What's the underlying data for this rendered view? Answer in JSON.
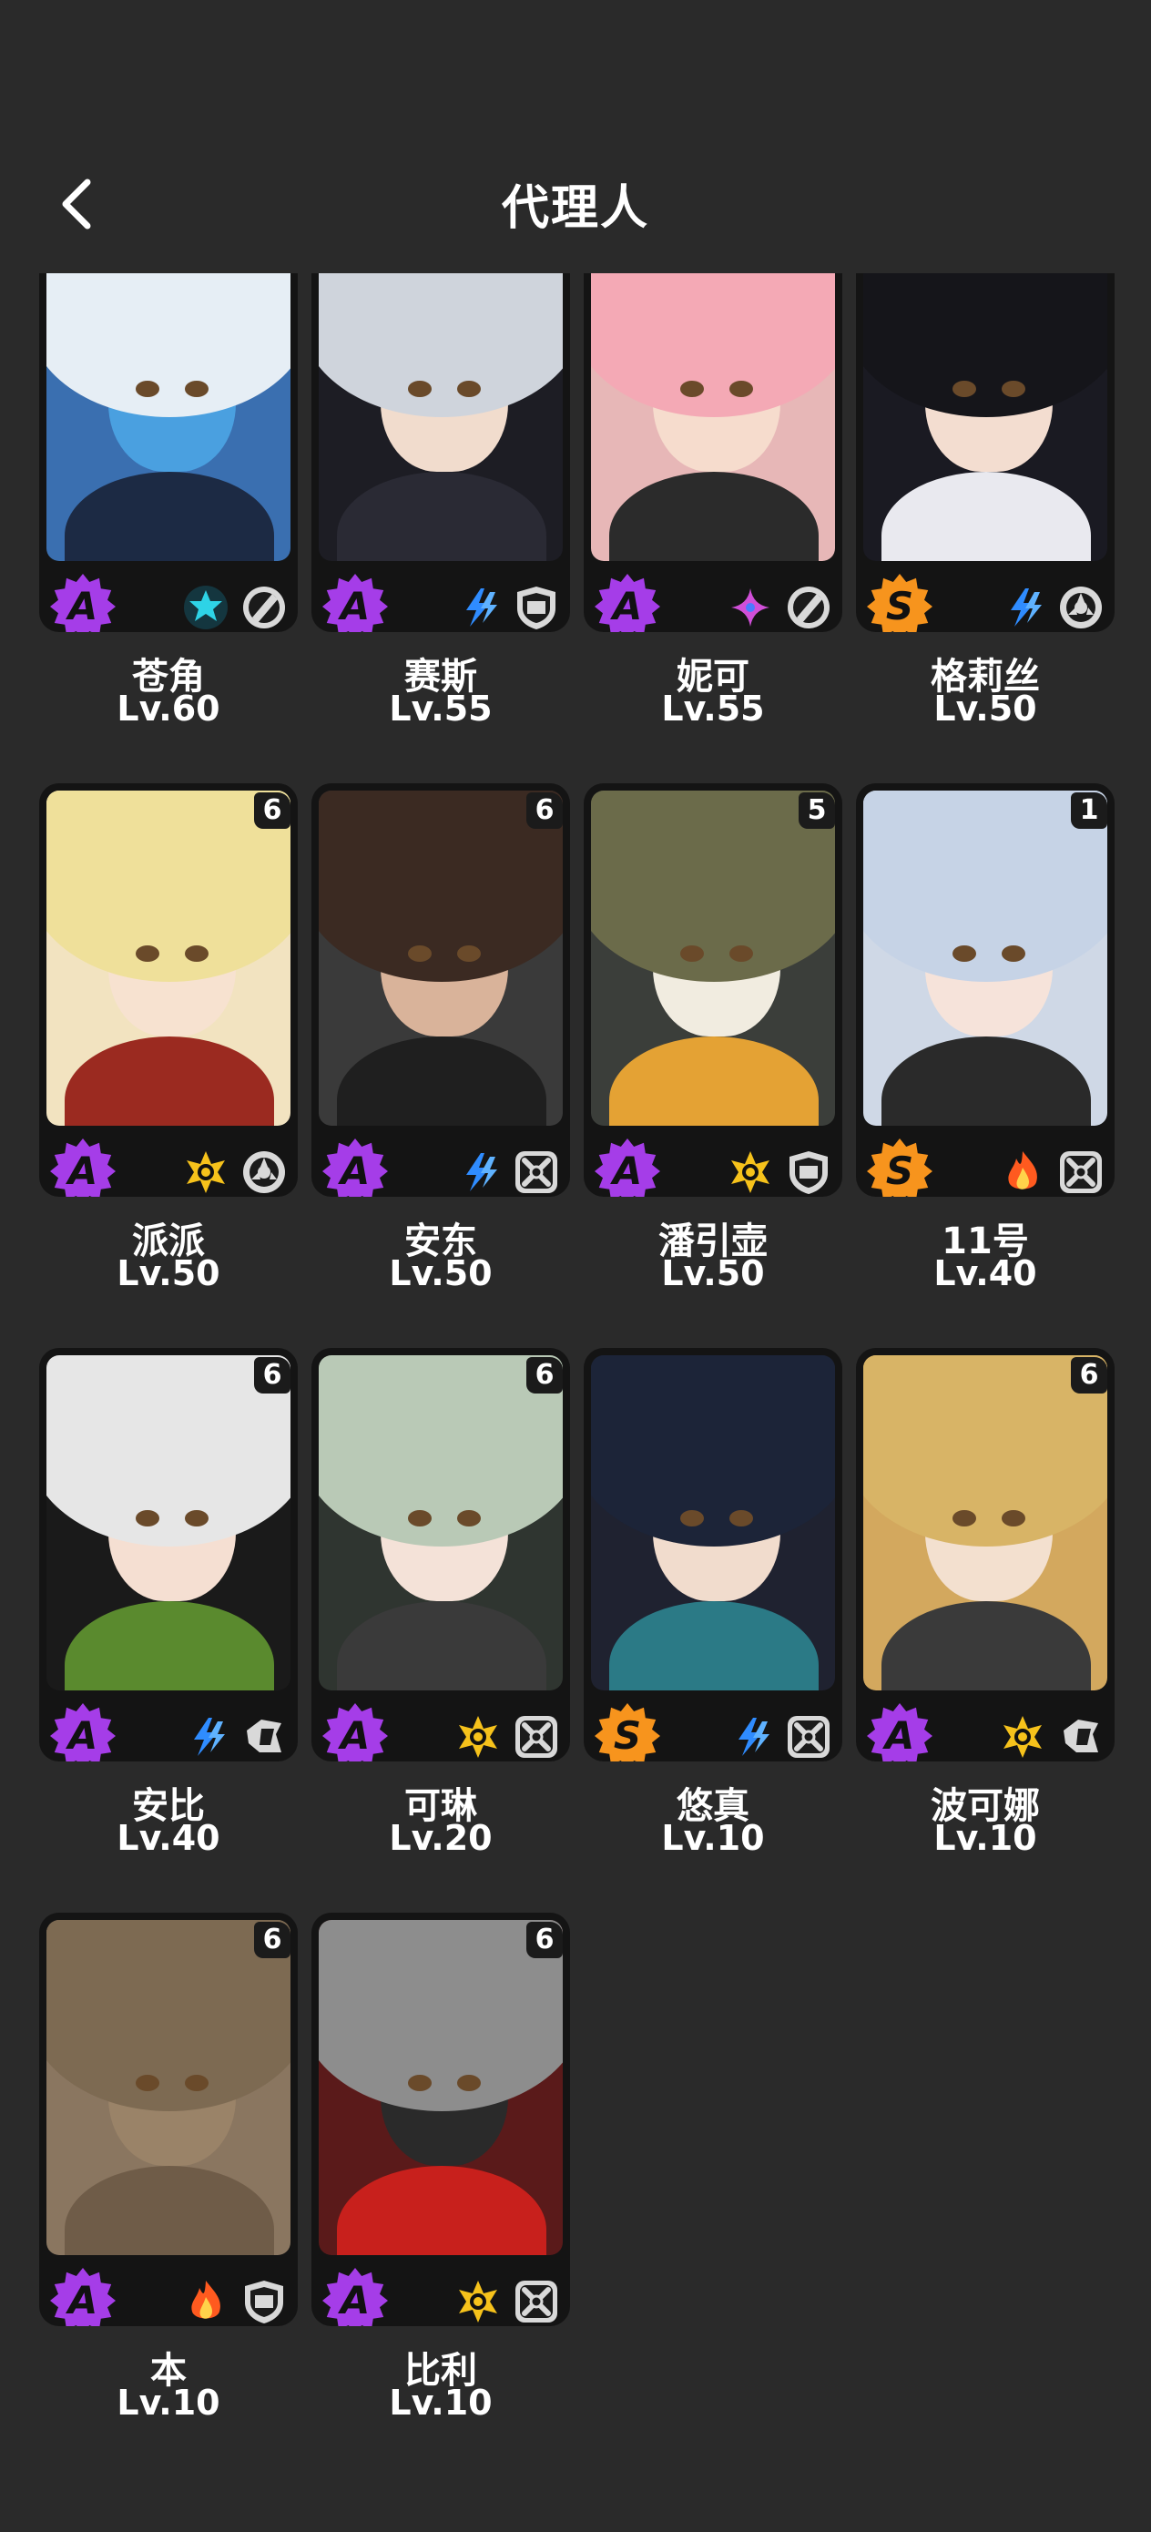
{
  "header": {
    "title": "代理人"
  },
  "colors": {
    "rank_A": "#a53de8",
    "rank_S": "#f7941d",
    "background": "#2a2a2a"
  },
  "agents": [
    {
      "name": "苍角",
      "level": "Lv.60",
      "rank": "A",
      "mindscape": "",
      "attribute": "ice-icon",
      "specialty": "support-icon"
    },
    {
      "name": "赛斯",
      "level": "Lv.55",
      "rank": "A",
      "mindscape": "",
      "attribute": "electric-icon",
      "specialty": "defense-icon"
    },
    {
      "name": "妮可",
      "level": "Lv.55",
      "rank": "A",
      "mindscape": "",
      "attribute": "ether-icon",
      "specialty": "support-icon"
    },
    {
      "name": "格莉丝",
      "level": "Lv.50",
      "rank": "S",
      "mindscape": "",
      "attribute": "electric-icon",
      "specialty": "anomaly-icon"
    },
    {
      "name": "派派",
      "level": "Lv.50",
      "rank": "A",
      "mindscape": "6",
      "attribute": "physical-icon",
      "specialty": "anomaly-icon"
    },
    {
      "name": "安东",
      "level": "Lv.50",
      "rank": "A",
      "mindscape": "6",
      "attribute": "electric-icon",
      "specialty": "attack-icon"
    },
    {
      "name": "潘引壶",
      "level": "Lv.50",
      "rank": "A",
      "mindscape": "5",
      "attribute": "physical-icon",
      "specialty": "defense-icon"
    },
    {
      "name": "11号",
      "level": "Lv.40",
      "rank": "S",
      "mindscape": "1",
      "attribute": "fire-icon",
      "specialty": "attack-icon"
    },
    {
      "name": "安比",
      "level": "Lv.40",
      "rank": "A",
      "mindscape": "6",
      "attribute": "electric-icon",
      "specialty": "stun-icon"
    },
    {
      "name": "可琳",
      "level": "Lv.20",
      "rank": "A",
      "mindscape": "6",
      "attribute": "physical-icon",
      "specialty": "attack-icon"
    },
    {
      "name": "悠真",
      "level": "Lv.10",
      "rank": "S",
      "mindscape": "",
      "attribute": "electric-icon",
      "specialty": "attack-icon"
    },
    {
      "name": "波可娜",
      "level": "Lv.10",
      "rank": "A",
      "mindscape": "6",
      "attribute": "physical-icon",
      "specialty": "stun-icon"
    },
    {
      "name": "本",
      "level": "Lv.10",
      "rank": "A",
      "mindscape": "6",
      "attribute": "fire-icon",
      "specialty": "defense-icon"
    },
    {
      "name": "比利",
      "level": "Lv.10",
      "rank": "A",
      "mindscape": "6",
      "attribute": "physical-icon",
      "specialty": "attack-icon"
    }
  ]
}
